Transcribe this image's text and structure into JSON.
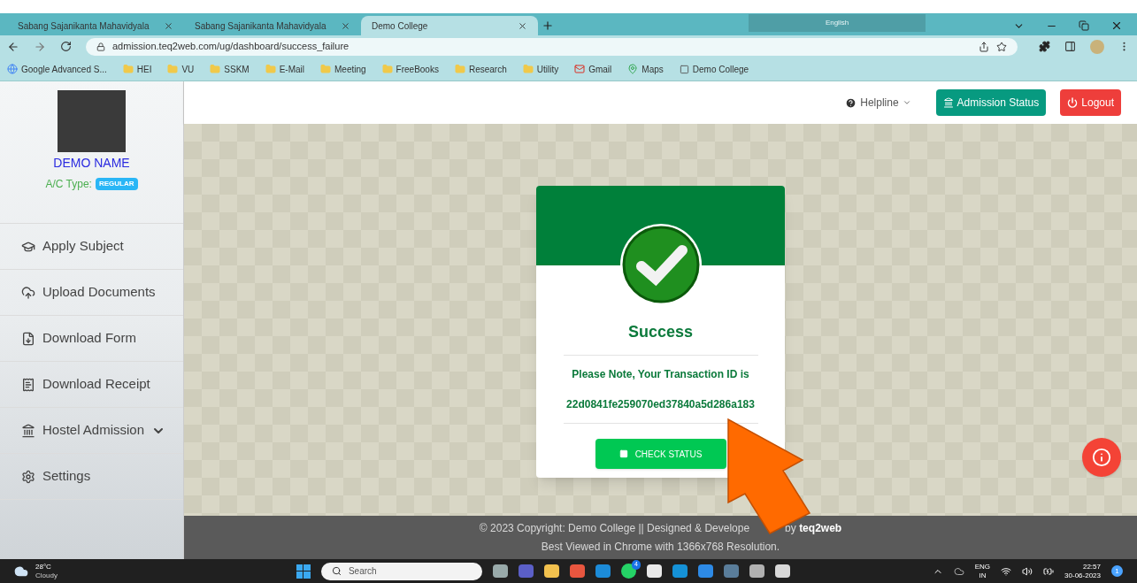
{
  "browser": {
    "tabs": [
      {
        "label": "Sabang Sajanikanta Mahavidyala",
        "selected": false
      },
      {
        "label": "Sabang Sajanikanta Mahavidyala",
        "selected": false
      },
      {
        "label": "Demo College",
        "selected": true
      }
    ],
    "language_bar": {
      "label": "English"
    },
    "address": "admission.teq2web.com/ug/dashboard/success_failure",
    "bookmarks": [
      {
        "label": "Google Advanced S...",
        "kind": "google"
      },
      {
        "label": "HEI",
        "kind": "folder"
      },
      {
        "label": "VU",
        "kind": "folder"
      },
      {
        "label": "SSKM",
        "kind": "folder"
      },
      {
        "label": "E-Mail",
        "kind": "folder"
      },
      {
        "label": "Meeting",
        "kind": "folder"
      },
      {
        "label": "FreeBooks",
        "kind": "folder"
      },
      {
        "label": "Research",
        "kind": "folder"
      },
      {
        "label": "Utility",
        "kind": "folder"
      },
      {
        "label": "Gmail",
        "kind": "mail"
      },
      {
        "label": "Maps",
        "kind": "map"
      },
      {
        "label": "Demo College",
        "kind": "site"
      }
    ]
  },
  "sidebar": {
    "user_name": "DEMO NAME",
    "account_label": "A/C Type:",
    "account_type": "REGULAR",
    "items": [
      {
        "label": "Apply Subject",
        "kind": "link"
      },
      {
        "label": "Upload Documents",
        "kind": "link"
      },
      {
        "label": "Download Form",
        "kind": "link"
      },
      {
        "label": "Download Receipt",
        "kind": "link"
      },
      {
        "label": "Hostel Admission",
        "kind": "menu"
      },
      {
        "label": "Settings",
        "kind": "link"
      }
    ]
  },
  "header": {
    "helpline": "Helpline",
    "admission_status": "Admission Status",
    "logout": "Logout"
  },
  "card": {
    "title": "Success",
    "note": "Please Note, Your Transaction ID is",
    "transaction_id": "22d0841fe259070ed37840a5d286a183",
    "button": "CHECK STATUS"
  },
  "footer": {
    "line_1_start": "© 2023 Copyright: Demo College || Designed & Develope",
    "line_1_end": "by **teq2web**",
    "line_2": "Best Viewed in Chrome with 1366x768 Resolution."
  },
  "taskbar": {
    "temperature": "28°C",
    "weather": "Cloudy",
    "search": "Search",
    "whatsapp_badge": "4",
    "language": "ENG",
    "region": "IN",
    "time": "22:57",
    "date": "30-06-2023",
    "notifications": "1"
  }
}
